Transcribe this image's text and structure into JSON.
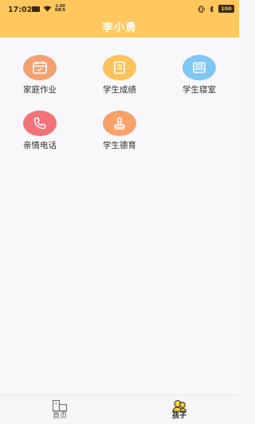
{
  "status_bar": {
    "time": "17:02",
    "net_speed_value": "2.00",
    "net_speed_unit": "KB/S",
    "battery": "100"
  },
  "header": {
    "title": "李小勇",
    "background_color": "#ffc75e"
  },
  "grid": {
    "items": [
      {
        "label": "家庭作业",
        "icon": "calendar-icon",
        "color": "#f2a070"
      },
      {
        "label": "学生成绩",
        "icon": "notepad-icon",
        "color": "#fbc35a"
      },
      {
        "label": "学生寝室",
        "icon": "bed-icon",
        "color": "#7fc7f4"
      },
      {
        "label": "亲情电话",
        "icon": "phone-icon",
        "color": "#f27277"
      },
      {
        "label": "学生德育",
        "icon": "stamp-icon",
        "color": "#f7a16b"
      }
    ]
  },
  "bottom_nav": {
    "tabs": [
      {
        "label": "首页",
        "icon": "home-icon",
        "active": false
      },
      {
        "label": "孩子",
        "icon": "children-icon",
        "active": true
      }
    ]
  }
}
